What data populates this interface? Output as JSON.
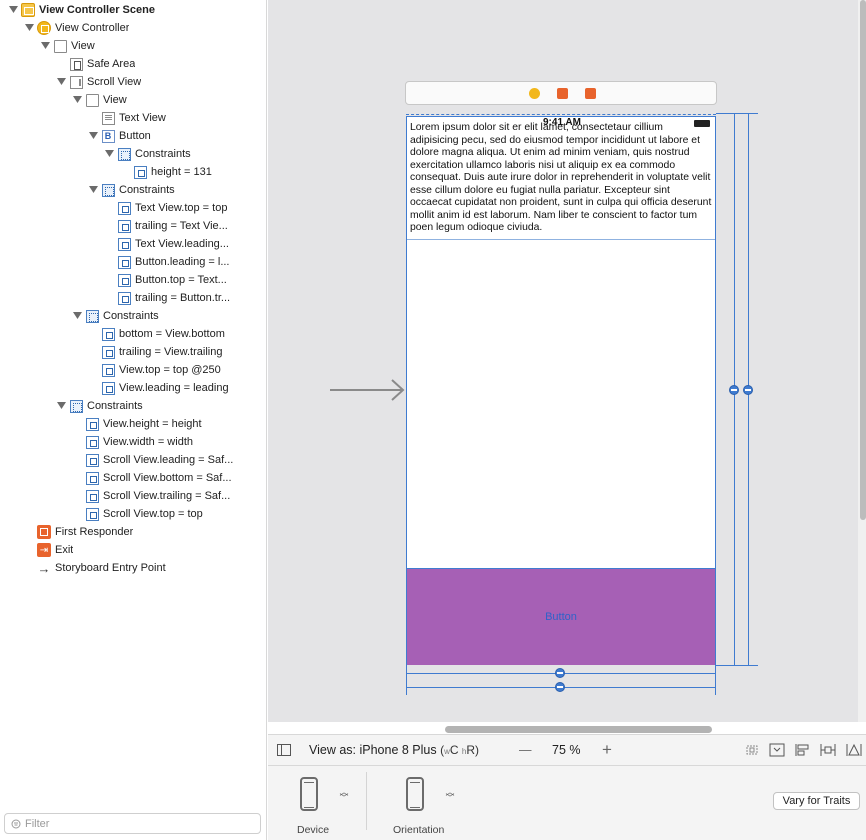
{
  "outline": {
    "items": [
      {
        "label": "View Controller Scene",
        "indent": 0,
        "icon": "scene-icon",
        "expanded": true,
        "bold": true
      },
      {
        "label": "View Controller",
        "indent": 1,
        "icon": "view-controller-icon",
        "expanded": true
      },
      {
        "label": "View",
        "indent": 2,
        "icon": "view-icon",
        "expanded": true
      },
      {
        "label": "Safe Area",
        "indent": 3,
        "icon": "safe-area-icon"
      },
      {
        "label": "Scroll View",
        "indent": 3,
        "icon": "scroll-view-icon",
        "expanded": true
      },
      {
        "label": "View",
        "indent": 4,
        "icon": "view-icon",
        "expanded": true
      },
      {
        "label": "Text View",
        "indent": 5,
        "icon": "text-view-icon"
      },
      {
        "label": "Button",
        "indent": 5,
        "icon": "button-icon",
        "expanded": true
      },
      {
        "label": "Constraints",
        "indent": 6,
        "icon": "constraints-icon",
        "expanded": true
      },
      {
        "label": "height = 131",
        "indent": 7,
        "icon": "constraint-icon"
      },
      {
        "label": "Constraints",
        "indent": 5,
        "icon": "constraints-icon",
        "expanded": true
      },
      {
        "label": "Text View.top = top",
        "indent": 6,
        "icon": "constraint-icon"
      },
      {
        "label": "trailing = Text Vie...",
        "indent": 6,
        "icon": "constraint-icon"
      },
      {
        "label": "Text View.leading...",
        "indent": 6,
        "icon": "constraint-icon"
      },
      {
        "label": "Button.leading = l...",
        "indent": 6,
        "icon": "constraint-icon"
      },
      {
        "label": "Button.top = Text...",
        "indent": 6,
        "icon": "constraint-icon"
      },
      {
        "label": "trailing = Button.tr...",
        "indent": 6,
        "icon": "constraint-icon"
      },
      {
        "label": "Constraints",
        "indent": 4,
        "icon": "constraints-icon",
        "expanded": true
      },
      {
        "label": "bottom = View.bottom",
        "indent": 5,
        "icon": "constraint-icon"
      },
      {
        "label": "trailing = View.trailing",
        "indent": 5,
        "icon": "constraint-icon"
      },
      {
        "label": "View.top = top @250",
        "indent": 5,
        "icon": "constraint-icon"
      },
      {
        "label": "View.leading = leading",
        "indent": 5,
        "icon": "constraint-icon"
      },
      {
        "label": "Constraints",
        "indent": 3,
        "icon": "constraints-icon",
        "expanded": true
      },
      {
        "label": "View.height = height",
        "indent": 4,
        "icon": "constraint-icon"
      },
      {
        "label": "View.width = width",
        "indent": 4,
        "icon": "constraint-icon"
      },
      {
        "label": "Scroll View.leading = Saf...",
        "indent": 4,
        "icon": "constraint-icon"
      },
      {
        "label": "Scroll View.bottom = Saf...",
        "indent": 4,
        "icon": "constraint-icon"
      },
      {
        "label": "Scroll View.trailing = Saf...",
        "indent": 4,
        "icon": "constraint-icon"
      },
      {
        "label": "Scroll View.top = top",
        "indent": 4,
        "icon": "constraint-icon"
      },
      {
        "label": "First Responder",
        "indent": 1,
        "icon": "first-responder-icon"
      },
      {
        "label": "Exit",
        "indent": 1,
        "icon": "exit-icon"
      },
      {
        "label": "Storyboard Entry Point",
        "indent": 1,
        "icon": "entry-point-icon"
      }
    ]
  },
  "filter": {
    "placeholder": "Filter"
  },
  "canvas": {
    "status_time": "9:41 AM",
    "text_view_body": "Lorem ipsum dolor sit er elit lamet, consectetaur cillium adipisicing pecu, sed do eiusmod tempor incididunt ut labore et dolore magna aliqua. Ut enim ad minim veniam, quis nostrud exercitation ullamco laboris nisi ut aliquip ex ea commodo consequat. Duis aute irure dolor in reprehenderit in voluptate velit esse cillum dolore eu fugiat nulla pariatur. Excepteur sint occaecat cupidatat non proident, sunt in culpa qui officia deserunt mollit anim id est laborum. Nam liber te conscient to factor tum poen legum odioque civiuda.",
    "button_label": "Button",
    "button_color": "#a660b5"
  },
  "bottom_bar": {
    "view_as_prefix": "View as: iPhone 8 Plus",
    "size_class_w": "w",
    "size_class_w_value": "C",
    "size_class_h": "h",
    "size_class_h_value": "R",
    "zoom_out": "—",
    "zoom": "75 %",
    "zoom_in": "+",
    "device_label": "Device",
    "orientation_label": "Orientation",
    "vary_label": "Vary for Traits"
  },
  "colors": {
    "accent": "#3f7bd0",
    "canvas_bg": "#e4e4e6"
  }
}
